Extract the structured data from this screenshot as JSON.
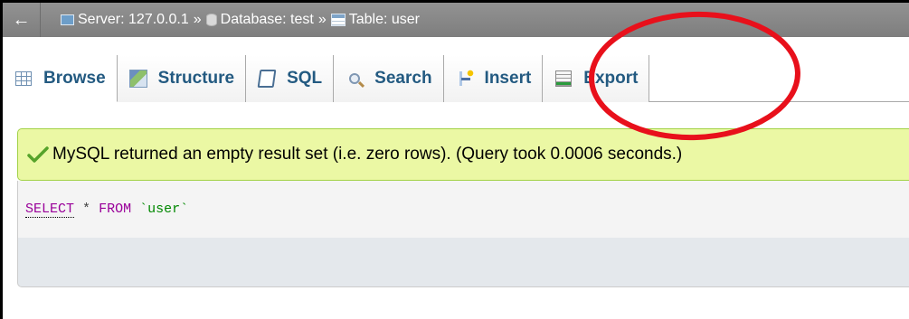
{
  "breadcrumb": {
    "back_label": "←",
    "server_label": "Server: 127.0.0.1",
    "database_label": "Database: test",
    "table_label": "Table: user",
    "separator": "»"
  },
  "tabs": [
    {
      "label": "Browse",
      "icon": "browse-icon",
      "active": true
    },
    {
      "label": "Structure",
      "icon": "structure-icon"
    },
    {
      "label": "SQL",
      "icon": "sql-icon"
    },
    {
      "label": "Search",
      "icon": "search-icon"
    },
    {
      "label": "Insert",
      "icon": "insert-icon"
    },
    {
      "label": "Export",
      "icon": "export-icon"
    }
  ],
  "message": {
    "text": "MySQL returned an empty result set (i.e. zero rows). (Query took 0.0006 seconds.)",
    "icon": "check-icon",
    "color": "#ebf8a4"
  },
  "query": {
    "select": "SELECT",
    "star": "*",
    "from": "FROM",
    "table": "`user`"
  },
  "annotation": {
    "color": "#e8101b",
    "shape": "ellipse"
  }
}
